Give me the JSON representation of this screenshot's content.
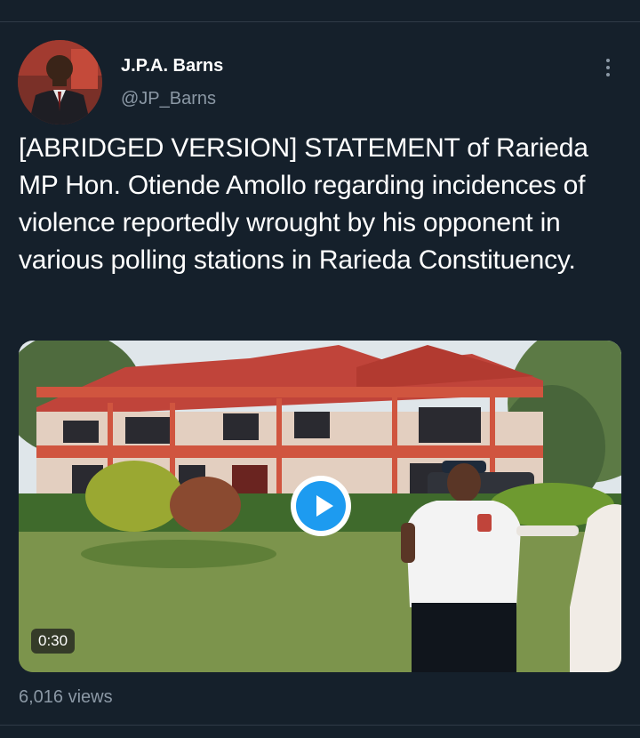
{
  "tweet": {
    "author_name": "J.P.A. Barns",
    "author_handle": "@JP_Barns",
    "text": "[ABRIDGED VERSION] STATEMENT of Rarieda MP Hon. Otiende Amollo regarding incidences of violence reportedly wrought by his opponent in various polling stations in Rarieda Constituency.",
    "video_duration": "0:30",
    "views": "6,016 views"
  },
  "icons": {
    "more": "more-vertical-icon",
    "play": "play-icon"
  },
  "colors": {
    "background": "#15202b",
    "text": "#ffffff",
    "muted": "#8b98a5",
    "accent": "#1d9bf0"
  }
}
